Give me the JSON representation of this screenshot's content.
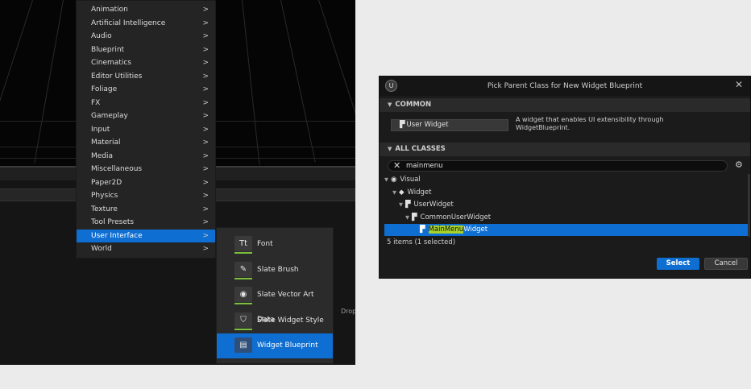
{
  "menu": {
    "items": [
      {
        "label": "Animation"
      },
      {
        "label": "Artificial Intelligence"
      },
      {
        "label": "Audio"
      },
      {
        "label": "Blueprint"
      },
      {
        "label": "Cinematics"
      },
      {
        "label": "Editor Utilities"
      },
      {
        "label": "Foliage"
      },
      {
        "label": "FX"
      },
      {
        "label": "Gameplay"
      },
      {
        "label": "Input"
      },
      {
        "label": "Material"
      },
      {
        "label": "Media"
      },
      {
        "label": "Miscellaneous"
      },
      {
        "label": "Paper2D"
      },
      {
        "label": "Physics"
      },
      {
        "label": "Texture"
      },
      {
        "label": "Tool Presets"
      },
      {
        "label": "User Interface"
      },
      {
        "label": "World"
      }
    ],
    "active_item": "User Interface",
    "submenu_chevron": ">"
  },
  "submenu": {
    "items": [
      {
        "label": "Font",
        "icon": "font-icon",
        "glyph": "Tt"
      },
      {
        "label": "Slate Brush",
        "icon": "slate-brush-icon",
        "glyph": "✎"
      },
      {
        "label": "Slate Vector Art Data",
        "icon": "vector-art-icon",
        "glyph": "◉"
      },
      {
        "label": "Slate Widget Style",
        "icon": "widget-style-icon",
        "glyph": "⛉"
      },
      {
        "label": "Widget Blueprint",
        "icon": "widget-blueprint-icon",
        "glyph": "▤"
      }
    ],
    "active_item": "Widget Blueprint"
  },
  "editor": {
    "drop_text": "Drop"
  },
  "dialog": {
    "logo": "U",
    "title": "Pick Parent Class for New Widget Blueprint",
    "close": "✕",
    "common_header": "COMMON",
    "common_button": "User Widget",
    "common_description": "A widget that enables UI extensibility through WidgetBlueprint.",
    "all_classes_header": "ALL CLASSES",
    "search_value": "mainmenu",
    "search_clear": "✕",
    "settings_glyph": "⚙",
    "tree": [
      {
        "label": "Visual"
      },
      {
        "label": "Widget"
      },
      {
        "label": "UserWidget"
      },
      {
        "label": "CommonUserWidget"
      },
      {
        "label_highlight": "MainMenu",
        "label_rest": "Widget"
      }
    ],
    "count_text": "5 items (1 selected)",
    "select_label": "Select",
    "cancel_label": "Cancel"
  },
  "colors": {
    "accent": "#0e6ed2",
    "search_highlight": "#a6d22a",
    "asset_underline": "#7bbf3c"
  }
}
